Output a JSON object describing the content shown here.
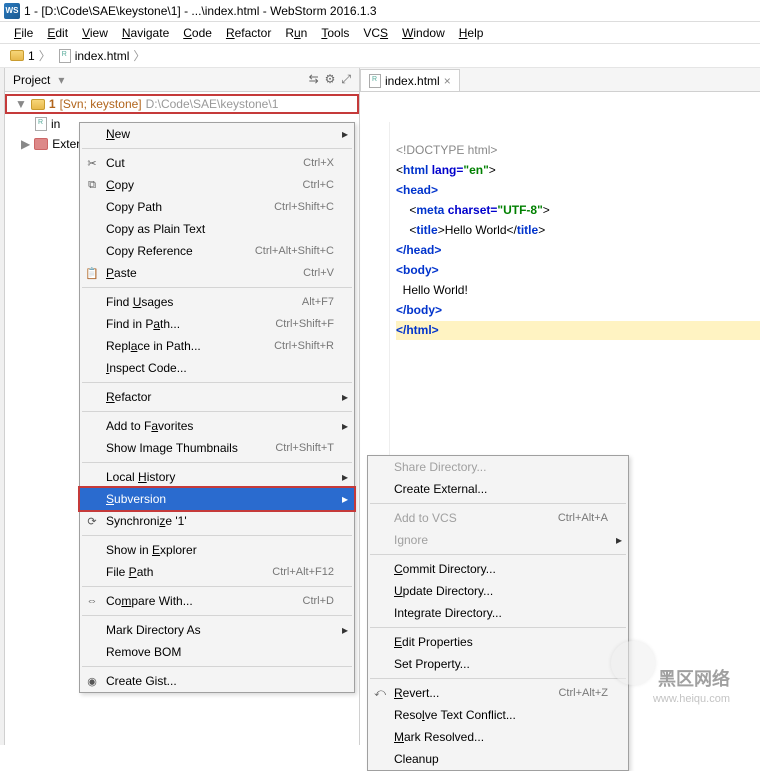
{
  "title": "1 - [D:\\Code\\SAE\\keystone\\1] - ...\\index.html - WebStorm 2016.1.3",
  "menubar": {
    "file": "File",
    "edit": "Edit",
    "view": "View",
    "navigate": "Navigate",
    "code": "Code",
    "refactor": "Refactor",
    "run": "Run",
    "tools": "Tools",
    "vcs": "VCS",
    "window": "Window",
    "help": "Help"
  },
  "crumbs": {
    "root": "1",
    "file": "index.html"
  },
  "project": {
    "title": "Project",
    "selected_name": "1",
    "selected_svn": "[Svn; keystone]",
    "selected_path": "D:\\Code\\SAE\\keystone\\1",
    "child1": "in",
    "child2": "Exter"
  },
  "tab": {
    "name": "index.html"
  },
  "code": {
    "l1": "<!DOCTYPE html>",
    "l2a": "<",
    "l2b": "html ",
    "l2c": "lang=",
    "l2d": "\"en\"",
    "l2e": ">",
    "l3": "<head>",
    "l4a": "    <",
    "l4b": "meta ",
    "l4c": "charset=",
    "l4d": "\"UTF-8\"",
    "l4e": ">",
    "l5a": "    <",
    "l5b": "title",
    "l5c": ">Hello World</",
    "l5d": "title",
    "l5e": ">",
    "l6": "</head>",
    "l7": "<body>",
    "l8": "  Hello World!",
    "l9": "</body>",
    "l10": "</html>"
  },
  "menu1": {
    "new": "New",
    "cut": "Cut",
    "cut_sc": "Ctrl+X",
    "copy": "Copy",
    "copy_sc": "Ctrl+C",
    "copypath": "Copy Path",
    "copypath_sc": "Ctrl+Shift+C",
    "copyplain": "Copy as Plain Text",
    "copyref": "Copy Reference",
    "copyref_sc": "Ctrl+Alt+Shift+C",
    "paste": "Paste",
    "paste_sc": "Ctrl+V",
    "findusages": "Find Usages",
    "findusages_sc": "Alt+F7",
    "findinpath": "Find in Path...",
    "findinpath_sc": "Ctrl+Shift+F",
    "replinpath": "Replace in Path...",
    "replinpath_sc": "Ctrl+Shift+R",
    "inspect": "Inspect Code...",
    "refactor": "Refactor",
    "addfav": "Add to Favorites",
    "thumbs": "Show Image Thumbnails",
    "thumbs_sc": "Ctrl+Shift+T",
    "localhist": "Local History",
    "subversion": "Subversion",
    "sync": "Synchronize '1'",
    "explorer": "Show in Explorer",
    "filepath": "File Path",
    "filepath_sc": "Ctrl+Alt+F12",
    "compare": "Compare With...",
    "compare_sc": "Ctrl+D",
    "markdir": "Mark Directory As",
    "removebom": "Remove BOM",
    "creategist": "Create Gist..."
  },
  "menu2": {
    "sharedir": "Share Directory...",
    "createext": "Create External...",
    "addvcs": "Add to VCS",
    "addvcs_sc": "Ctrl+Alt+A",
    "ignore": "Ignore",
    "commitdir": "Commit Directory...",
    "updatedir": "Update Directory...",
    "integrate": "Integrate Directory...",
    "editprops": "Edit Properties",
    "setprop": "Set Property...",
    "revert": "Revert...",
    "revert_sc": "Ctrl+Alt+Z",
    "resolve": "Resolve Text Conflict...",
    "markresolved": "Mark Resolved...",
    "cleanup": "Cleanup"
  },
  "watermark": {
    "text": "黑区网络",
    "url": "www.heiqu.com"
  }
}
